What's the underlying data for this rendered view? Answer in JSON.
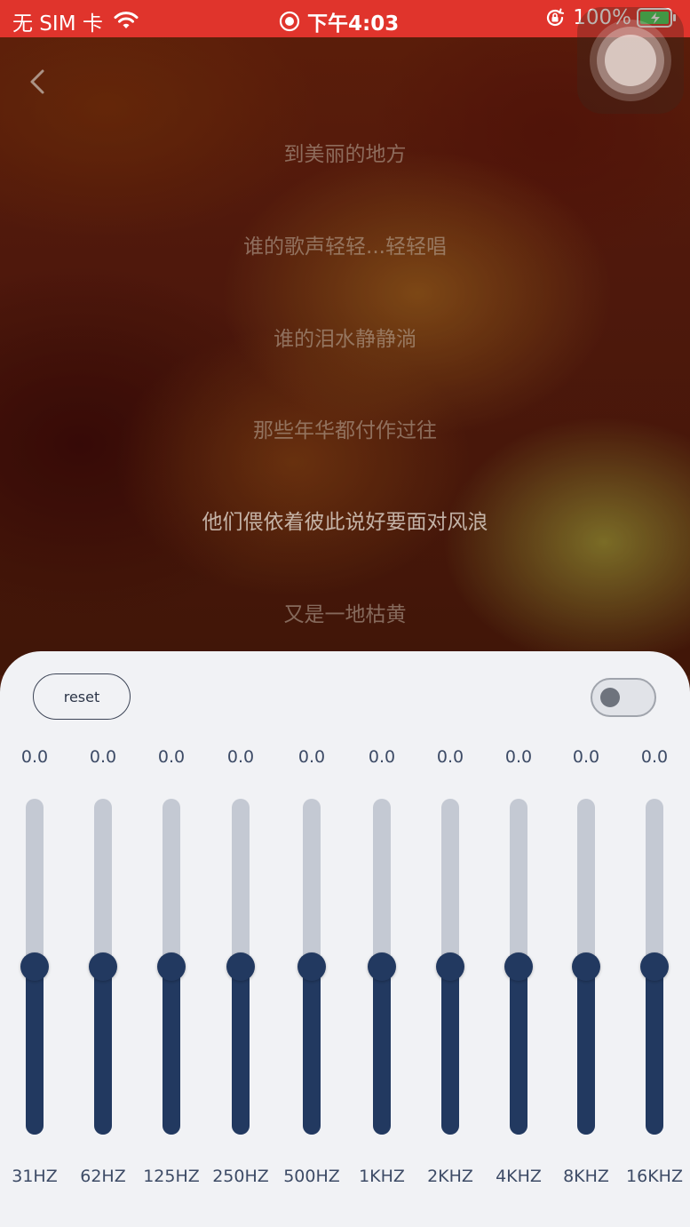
{
  "status_bar": {
    "carrier": "无 SIM 卡",
    "time": "下午4:03",
    "battery": "100%"
  },
  "icons": {
    "back": "chevron-left-icon",
    "wifi": "wifi-icon",
    "record": "screen-record-icon",
    "rotation_lock": "rotation-lock-icon",
    "battery": "battery-charging-icon"
  },
  "lyrics": [
    {
      "text": "到美丽的地方",
      "active": false
    },
    {
      "text": "谁的歌声轻轻...轻轻唱",
      "active": false
    },
    {
      "text": "谁的泪水静静淌",
      "active": false
    },
    {
      "text": "那些年华都付作过往",
      "active": false
    },
    {
      "text": "他们偎依着彼此说好要面对风浪",
      "active": true
    },
    {
      "text": "又是一地枯黄",
      "active": false
    }
  ],
  "equalizer": {
    "reset_label": "reset",
    "enabled": false,
    "range_db": [
      -12,
      12
    ],
    "bands": [
      {
        "label": "31HZ",
        "value": "0.0",
        "gain": 0.0
      },
      {
        "label": "62HZ",
        "value": "0.0",
        "gain": 0.0
      },
      {
        "label": "125HZ",
        "value": "0.0",
        "gain": 0.0
      },
      {
        "label": "250HZ",
        "value": "0.0",
        "gain": 0.0
      },
      {
        "label": "500HZ",
        "value": "0.0",
        "gain": 0.0
      },
      {
        "label": "1KHZ",
        "value": "0.0",
        "gain": 0.0
      },
      {
        "label": "2KHZ",
        "value": "0.0",
        "gain": 0.0
      },
      {
        "label": "4KHZ",
        "value": "0.0",
        "gain": 0.0
      },
      {
        "label": "8KHZ",
        "value": "0.0",
        "gain": 0.0
      },
      {
        "label": "16KHZ",
        "value": "0.0",
        "gain": 0.0
      }
    ]
  },
  "colors": {
    "status_bar": "#e0342c",
    "slider_fill": "#223960",
    "slider_track": "#c4c9d3",
    "panel_bg": "#f1f2f5"
  }
}
